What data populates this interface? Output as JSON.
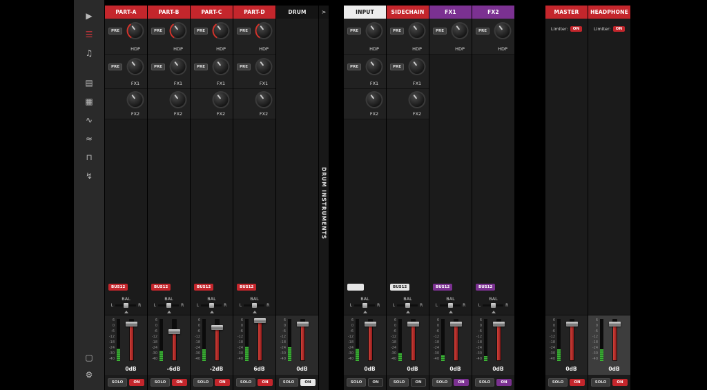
{
  "colors": {
    "accent_red": "#c4262c",
    "accent_purple": "#7b3191",
    "meter_green": "#3cb234",
    "fader_red": "#c03028",
    "header_white": "#ececec"
  },
  "sidebar": {
    "top_icons": [
      {
        "name": "video-roll-icon",
        "glyph": "▶",
        "active": false
      },
      {
        "name": "mixer-icon",
        "glyph": "☰",
        "active": true
      },
      {
        "name": "song-notes-icon",
        "glyph": "♫",
        "active": false
      },
      {
        "name": "clipboard-icon",
        "glyph": "▤",
        "active": false
      },
      {
        "name": "pattern-grid-icon",
        "glyph": "▦",
        "active": false
      },
      {
        "name": "waveform-icon",
        "glyph": "∿",
        "active": false
      },
      {
        "name": "waveform-alt-icon",
        "glyph": "≈",
        "active": false
      },
      {
        "name": "pulse-icon",
        "glyph": "⊓",
        "active": false
      },
      {
        "name": "trigger-icon",
        "glyph": "↯",
        "active": false
      }
    ],
    "bottom_icons": [
      {
        "name": "monitor-icon",
        "glyph": "▢"
      },
      {
        "name": "settings-gear-icon",
        "glyph": "⚙"
      }
    ]
  },
  "strings": {
    "pre": "PRE",
    "bal": "BAL",
    "left": "L",
    "right": "R",
    "solo": "SOLO"
  },
  "fader_scale_ticks": [
    "6",
    "0",
    "-6",
    "-12",
    "-18",
    "-24",
    "-30",
    "-40"
  ],
  "groups": [
    {
      "channels": [
        {
          "id": "part-a",
          "title": "PART-A",
          "header_style": "red",
          "sends": [
            {
              "pre": true,
              "label": "HDP",
              "arc": true
            },
            {
              "pre": true,
              "label": "FX1"
            },
            {
              "pre": false,
              "label": "FX2"
            }
          ],
          "bus": {
            "label": "BUS12",
            "style": "red"
          },
          "has_bal": true,
          "fader": {
            "value": "0dB",
            "handle_pct": 11,
            "meter_pct": 30
          },
          "on": {
            "label": "ON",
            "style": "red"
          }
        },
        {
          "id": "part-b",
          "title": "PART-B",
          "header_style": "red",
          "sends": [
            {
              "pre": true,
              "label": "HDP",
              "arc": true
            },
            {
              "pre": true,
              "label": "FX1"
            },
            {
              "pre": false,
              "label": "FX2"
            }
          ],
          "bus": {
            "label": "BUS12",
            "style": "red"
          },
          "has_bal": true,
          "fader": {
            "value": "-6dB",
            "handle_pct": 30,
            "meter_pct": 24
          },
          "on": {
            "label": "ON",
            "style": "red"
          }
        },
        {
          "id": "part-c",
          "title": "PART-C",
          "header_style": "red",
          "sends": [
            {
              "pre": true,
              "label": "HDP",
              "arc": true
            },
            {
              "pre": true,
              "label": "FX1"
            },
            {
              "pre": false,
              "label": "FX2"
            }
          ],
          "bus": {
            "label": "BUS12",
            "style": "red"
          },
          "has_bal": true,
          "fader": {
            "value": "-2dB",
            "handle_pct": 19,
            "meter_pct": 28
          },
          "on": {
            "label": "ON",
            "style": "red"
          }
        },
        {
          "id": "part-d",
          "title": "PART-D",
          "header_style": "red",
          "sends": [
            {
              "pre": true,
              "label": "HDP",
              "arc": true
            },
            {
              "pre": true,
              "label": "FX1"
            },
            {
              "pre": false,
              "label": "FX2"
            }
          ],
          "bus": {
            "label": "BUS12",
            "style": "red"
          },
          "has_bal": true,
          "fader": {
            "value": "6dB",
            "handle_pct": 3,
            "meter_pct": 34
          },
          "on": {
            "label": "ON",
            "style": "red"
          }
        },
        {
          "id": "drum",
          "title": "DRUM",
          "header_style": "dark",
          "sends": [],
          "bus": null,
          "has_bal": false,
          "tone": "mid",
          "fader": {
            "value": "0dB",
            "handle_pct": 11,
            "meter_pct": 32
          },
          "on": {
            "label": "ON",
            "style": "white"
          }
        }
      ],
      "collapsed": {
        "arrow": ">",
        "label": "DRUM INSTRUMENTS"
      }
    },
    {
      "channels": [
        {
          "id": "input",
          "title": "INPUT",
          "header_style": "white",
          "sends": [
            {
              "pre": true,
              "label": "HDP"
            },
            {
              "pre": true,
              "label": "FX1"
            },
            {
              "pre": false,
              "label": "FX2"
            }
          ],
          "bus": {
            "label": "",
            "style": "white"
          },
          "has_bal": true,
          "fader": {
            "value": "0dB",
            "handle_pct": 11,
            "meter_pct": 30
          },
          "on": {
            "label": "ON",
            "style": "dark"
          }
        },
        {
          "id": "sidechain",
          "title": "SIDECHAIN",
          "header_style": "red",
          "sends": [
            {
              "pre": true,
              "label": "HDP"
            },
            {
              "pre": true,
              "label": "FX1"
            },
            {
              "pre": false,
              "label": "FX2"
            }
          ],
          "bus": {
            "label": "BUS12",
            "style": "white"
          },
          "has_bal": true,
          "fader": {
            "value": "0dB",
            "handle_pct": 11,
            "meter_pct": 20
          },
          "on": {
            "label": "ON",
            "style": "dark"
          }
        },
        {
          "id": "fx1",
          "title": "FX1",
          "header_style": "purple",
          "sends": [
            {
              "pre": true,
              "label": "HDP"
            }
          ],
          "bus": {
            "label": "BUS12",
            "style": "purple"
          },
          "has_bal": true,
          "fader": {
            "value": "0dB",
            "handle_pct": 11,
            "meter_pct": 14
          },
          "on": {
            "label": "ON",
            "style": "purple"
          }
        },
        {
          "id": "fx2",
          "title": "FX2",
          "header_style": "purple",
          "sends": [
            {
              "pre": true,
              "label": "HDP"
            }
          ],
          "bus": {
            "label": "BUS12",
            "style": "purple"
          },
          "has_bal": true,
          "fader": {
            "value": "0dB",
            "handle_pct": 11,
            "meter_pct": 12
          },
          "on": {
            "label": "ON",
            "style": "purple"
          }
        }
      ]
    },
    {
      "channels": [
        {
          "id": "master",
          "title": "MASTER",
          "header_style": "red",
          "limiter": {
            "label": "Limiter:",
            "on": "ON"
          },
          "sends": [],
          "bus": null,
          "has_bal": false,
          "fader": {
            "value": "0dB",
            "handle_pct": 11,
            "meter_pct": 28
          },
          "on": {
            "label": "ON",
            "style": "red"
          }
        },
        {
          "id": "headphone",
          "title": "HEADPHONE",
          "header_style": "red",
          "limiter": {
            "label": "Limiter:",
            "on": "ON"
          },
          "sends": [],
          "bus": null,
          "has_bal": false,
          "tone": "light",
          "fader": {
            "value": "0dB",
            "handle_pct": 11,
            "meter_pct": 28
          },
          "on": {
            "label": "ON",
            "style": "red"
          }
        }
      ]
    }
  ]
}
